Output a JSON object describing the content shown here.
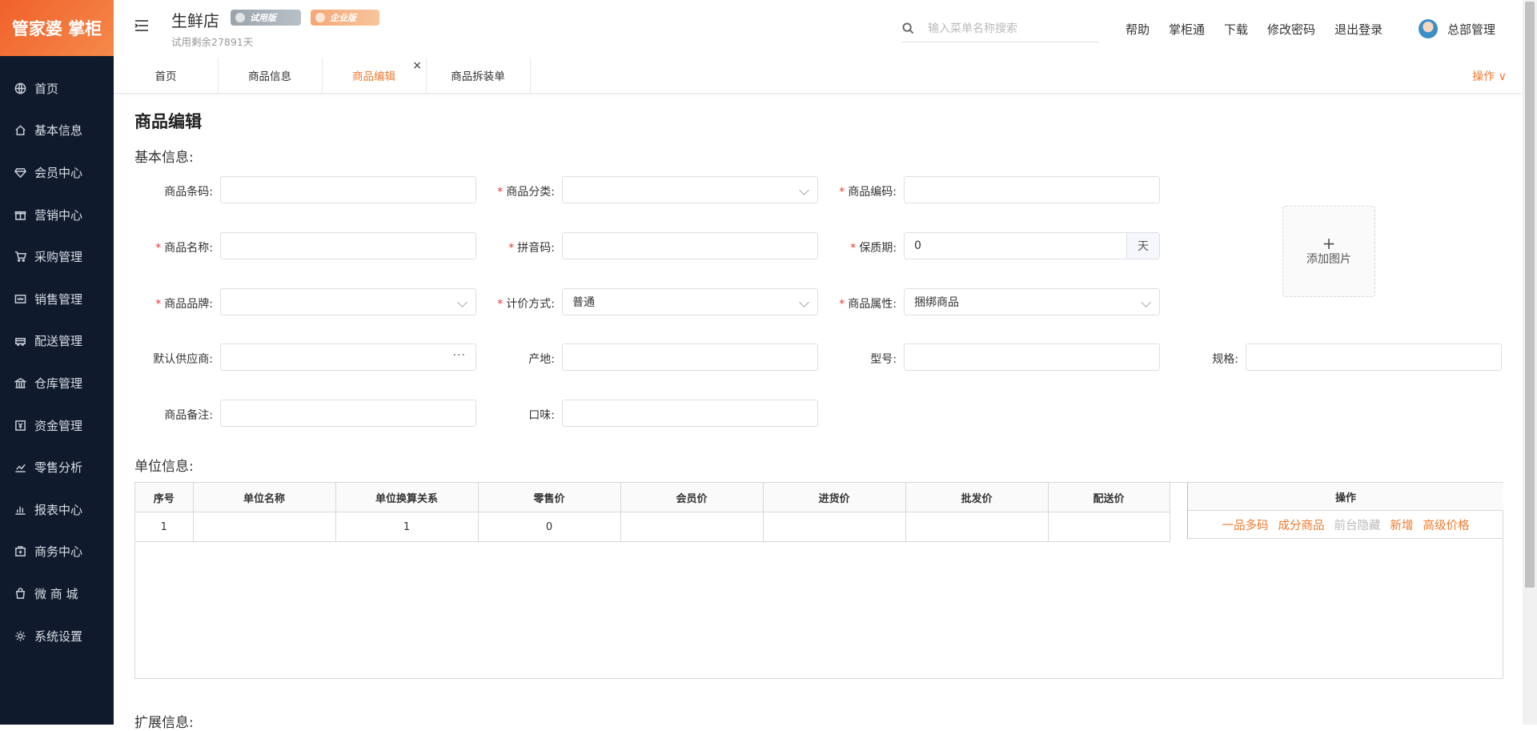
{
  "app": {
    "logo_text": "管家婆 掌柜"
  },
  "sidebar": {
    "items": [
      {
        "label": "首页",
        "icon": "globe-icon"
      },
      {
        "label": "基本信息",
        "icon": "home-icon"
      },
      {
        "label": "会员中心",
        "icon": "diamond-icon"
      },
      {
        "label": "营销中心",
        "icon": "gift-icon"
      },
      {
        "label": "采购管理",
        "icon": "cart-icon"
      },
      {
        "label": "销售管理",
        "icon": "wallet-icon"
      },
      {
        "label": "配送管理",
        "icon": "truck-icon"
      },
      {
        "label": "仓库管理",
        "icon": "bank-icon"
      },
      {
        "label": "资金管理",
        "icon": "money-icon"
      },
      {
        "label": "零售分析",
        "icon": "chart-icon"
      },
      {
        "label": "报表中心",
        "icon": "bar-chart-icon"
      },
      {
        "label": "商务中心",
        "icon": "briefcase-icon"
      },
      {
        "label": "微 商 城",
        "icon": "bag-icon"
      },
      {
        "label": "系统设置",
        "icon": "gear-icon"
      }
    ]
  },
  "header": {
    "store_name": "生鲜店",
    "badge_trial": "试用版",
    "badge_enterprise": "企业版",
    "trial_days": "试用剩余27891天",
    "search_placeholder": "输入菜单名称搜索",
    "links": [
      "帮助",
      "掌柜通",
      "下载",
      "修改密码",
      "退出登录"
    ],
    "user_name": "总部管理"
  },
  "tabs": {
    "items": [
      "首页",
      "商品信息",
      "商品编辑",
      "商品拆装单"
    ],
    "active": "商品编辑",
    "close_symbol": "×",
    "ops_label": "操作 ∨"
  },
  "form": {
    "page_title": "商品编辑",
    "basic_section": "基本信息:",
    "unit_section": "单位信息:",
    "ext_section": "扩展信息:",
    "labels": {
      "barcode": "商品条码:",
      "category": "商品分类:",
      "code": "商品编码:",
      "name": "商品名称:",
      "pinyin": "拼音码:",
      "shelf_life": "保质期:",
      "brand": "商品品牌:",
      "pricing": "计价方式:",
      "attribute": "商品属性:",
      "supplier": "默认供应商:",
      "origin": "产地:",
      "model": "型号:",
      "spec": "规格:",
      "remark": "商品备注:",
      "flavor": "口味:"
    },
    "values": {
      "shelf_life": "0",
      "shelf_life_unit": "天",
      "pricing": "普通",
      "attribute": "捆绑商品"
    },
    "required_mark": "*",
    "upload_plus": "+",
    "upload_label": "添加图片",
    "supplier_dots": "···"
  },
  "unit_table": {
    "headers": [
      "序号",
      "单位名称",
      "单位换算关系",
      "零售价",
      "会员价",
      "进货价",
      "批发价",
      "配送价"
    ],
    "rows": [
      [
        "1",
        "",
        "1",
        "0",
        "",
        "",
        "",
        ""
      ]
    ],
    "ops_header": "操作",
    "ops": [
      "一品多码",
      "成分商品",
      "前台隐藏",
      "新增",
      "高级价格"
    ]
  },
  "colors": {
    "accent": "#f07b30",
    "sidebar_bg": "#0f1a2c",
    "required": "#e53935"
  }
}
